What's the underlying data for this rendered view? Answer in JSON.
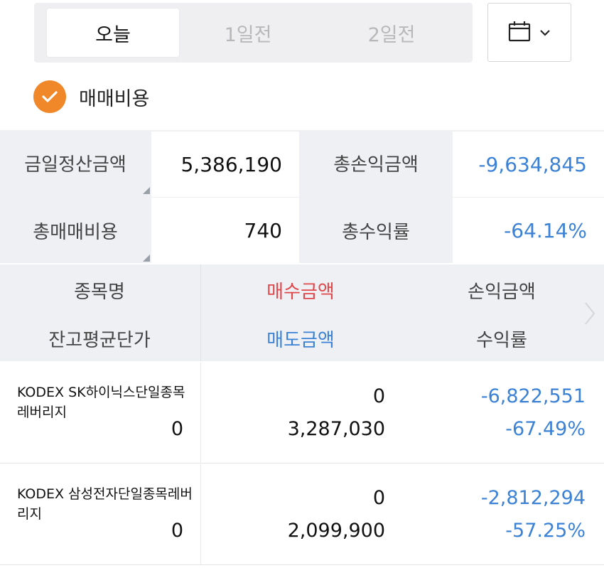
{
  "tabs": [
    {
      "label": "오늘",
      "active": true
    },
    {
      "label": "1일전",
      "active": false
    },
    {
      "label": "2일전",
      "active": false
    }
  ],
  "calendar_button": {
    "icon": "calendar-icon",
    "dropdown_icon": "chevron-down-icon"
  },
  "fee_option": {
    "label": "매매비용",
    "checked": true,
    "color": "#f0882a"
  },
  "summary": {
    "settlement_label": "금일정산금액",
    "settlement_value": "5,386,190",
    "total_pl_label": "총손익금액",
    "total_pl_value": "-9,634,845",
    "total_fee_label": "총매매비용",
    "total_fee_value": "740",
    "total_return_label": "총수익률",
    "total_return_value": "-64.14%"
  },
  "table": {
    "headers": {
      "name": "종목명",
      "buy_amount": "매수금액",
      "pl_amount": "손익금액",
      "avg_price": "잔고평균단가",
      "sell_amount": "매도금액",
      "return_rate": "수익률"
    },
    "rows": [
      {
        "name": "KODEX SK하이닉스단일종목레버리지",
        "avg_price": "0",
        "buy_amount": "0",
        "sell_amount": "3,287,030",
        "pl_amount": "-6,822,551",
        "return_rate": "-67.49%"
      },
      {
        "name": "KODEX 삼성전자단일종목레버리지",
        "avg_price": "0",
        "buy_amount": "0",
        "sell_amount": "2,099,900",
        "pl_amount": "-2,812,294",
        "return_rate": "-57.25%"
      }
    ]
  },
  "colors": {
    "accent": "#f0882a",
    "negative": "#3b82d6",
    "buy": "#e0474b"
  }
}
